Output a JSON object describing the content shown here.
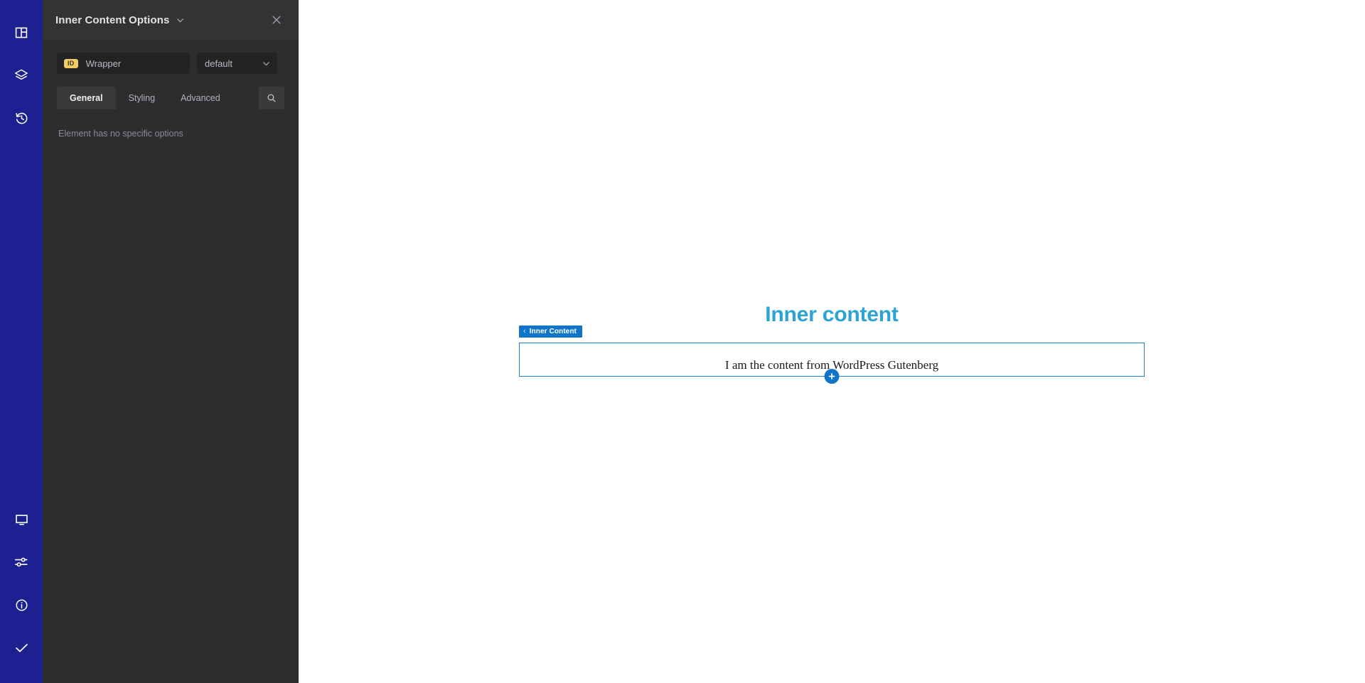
{
  "icon_rail": {
    "top_items": [
      {
        "name": "layout-icon",
        "label": "Layout"
      },
      {
        "name": "layers-icon",
        "label": "Layers"
      },
      {
        "name": "history-icon",
        "label": "History"
      }
    ],
    "bottom_items": [
      {
        "name": "display-icon",
        "label": "Responsive preview"
      },
      {
        "name": "sliders-icon",
        "label": "Settings"
      },
      {
        "name": "info-icon",
        "label": "Info"
      },
      {
        "name": "check-icon",
        "label": "Save"
      }
    ],
    "background_color": "#1d2090"
  },
  "panel": {
    "title": "Inner Content Options",
    "title_caret_icon": "chevron-down-icon",
    "close_icon": "close-icon",
    "id_field": {
      "badge": "ID",
      "value": "Wrapper",
      "placeholder": "Wrapper"
    },
    "preset_select": {
      "value": "default",
      "caret_icon": "chevron-down-icon"
    },
    "tabs": [
      {
        "label": "General",
        "active": true
      },
      {
        "label": "Styling",
        "active": false
      },
      {
        "label": "Advanced",
        "active": false
      }
    ],
    "search_icon": "search-icon",
    "empty_message": "Element has no specific options"
  },
  "canvas": {
    "heading": "Inner content",
    "heading_color": "#2aa3d6",
    "block_tag": {
      "caret": "‹",
      "label": "Inner Content",
      "color": "#1074c8"
    },
    "block_text": "I am the content from WordPress Gutenberg",
    "add_button": {
      "name": "add-element-button",
      "symbol": "+"
    },
    "border_color": "#1b7fd4"
  }
}
